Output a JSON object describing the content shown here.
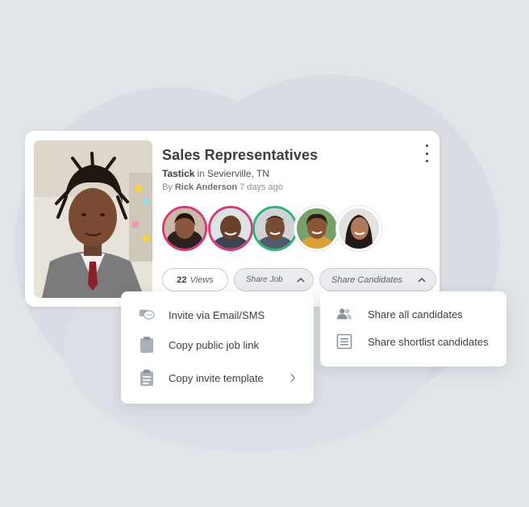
{
  "job": {
    "title": "Sales Representatives",
    "company": "Tastick",
    "in_word": "in",
    "location": "Sevierville, TN",
    "by_word": "By",
    "author": "Rick Anderson",
    "posted": "7 days ago"
  },
  "icons": {
    "menu": "more-vertical-icon",
    "share_job_chevron": "chevron-up-icon",
    "share_candidates_chevron": "chevron-up-icon"
  },
  "avatar_ring_colors": [
    "#d63a78",
    "#d63a78",
    "#2fb37a",
    "#ffffff",
    "#ffffff"
  ],
  "stats": {
    "views_count": "22",
    "views_label": "Views"
  },
  "buttons": {
    "share_job": "Share Job",
    "share_candidates": "Share Candidates"
  },
  "share_job_menu": {
    "items": [
      {
        "label": "Invite via Email/SMS",
        "icon": "chat-bubble-icon"
      },
      {
        "label": "Copy public job link",
        "icon": "clipboard-icon"
      },
      {
        "label": "Copy invite template",
        "icon": "clipboard-list-icon",
        "has_submenu": true
      }
    ]
  },
  "share_candidates_menu": {
    "items": [
      {
        "label": "Share all candidates",
        "icon": "users-icon"
      },
      {
        "label": "Share shortlist candidates",
        "icon": "list-icon"
      }
    ]
  }
}
